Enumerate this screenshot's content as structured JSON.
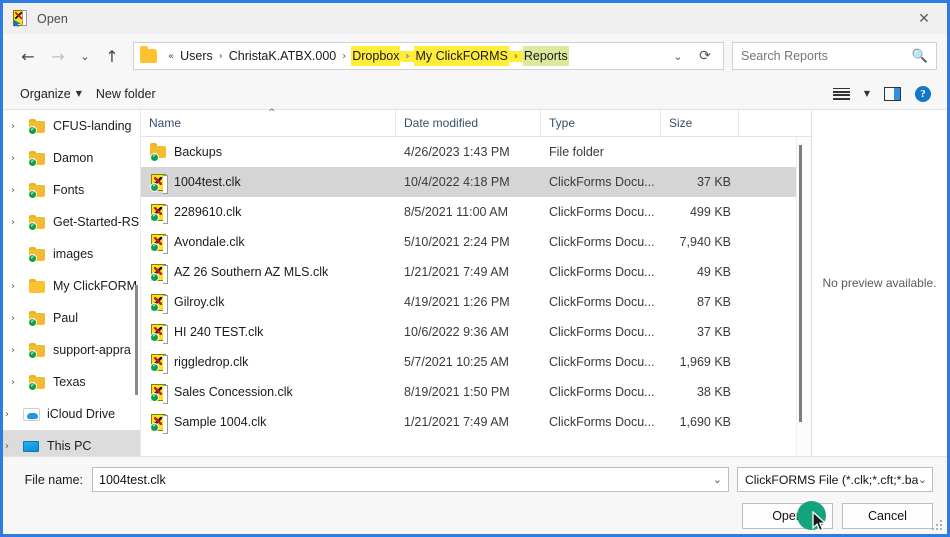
{
  "window": {
    "title": "Open",
    "title_icon": "clickforms-document-icon",
    "close_label": "✕"
  },
  "nav": {
    "back": "←",
    "forward": "→",
    "recent": "⌄",
    "up": "↑"
  },
  "breadcrumb": {
    "folder_icon": "folder-icon",
    "overflow": "«",
    "items": [
      {
        "label": "Users",
        "highlighted": false
      },
      {
        "label": "ChristaK.ATBX.000",
        "highlighted": false
      },
      {
        "label": "Dropbox",
        "highlighted": true
      },
      {
        "label": "My ClickFORMS",
        "highlighted": true
      },
      {
        "label": "Reports",
        "highlighted": true,
        "selected": true
      }
    ],
    "dropdown": "⌄",
    "refresh": "⟳"
  },
  "search": {
    "placeholder": "Search Reports",
    "icon": "search-icon"
  },
  "toolbar": {
    "organize_label": "Organize",
    "organize_caret": "▼",
    "new_folder_label": "New folder",
    "view_icon": "view-list-icon",
    "view_caret": "▼",
    "preview_pane_icon": "preview-pane-icon",
    "help_icon": "help-icon",
    "help_glyph": "?"
  },
  "sidebar": {
    "items": [
      {
        "label": "CFUS-landing",
        "icon": "folder-synced-icon",
        "expander": "›",
        "selected": false
      },
      {
        "label": "Damon",
        "icon": "folder-synced-icon",
        "expander": "›",
        "selected": false
      },
      {
        "label": "Fonts",
        "icon": "folder-synced-icon",
        "expander": "›",
        "selected": false
      },
      {
        "label": "Get-Started-RS",
        "icon": "folder-synced-icon",
        "expander": "›",
        "selected": false
      },
      {
        "label": "images",
        "icon": "folder-synced-icon",
        "expander": "",
        "selected": false
      },
      {
        "label": "My ClickFORM",
        "icon": "folder-icon",
        "expander": "›",
        "selected": false
      },
      {
        "label": "Paul",
        "icon": "folder-synced-icon",
        "expander": "›",
        "selected": false
      },
      {
        "label": "support-appra",
        "icon": "folder-synced-icon",
        "expander": "›",
        "selected": false
      },
      {
        "label": "Texas",
        "icon": "folder-synced-icon",
        "expander": "›",
        "selected": false
      },
      {
        "label": "iCloud Drive",
        "icon": "icloud-icon",
        "expander": "›",
        "selected": false
      },
      {
        "label": "This PC",
        "icon": "this-pc-icon",
        "expander": "›",
        "selected": true
      }
    ]
  },
  "filelist": {
    "columns": [
      {
        "label": "Name",
        "sorted": true,
        "sort_glyph": "^"
      },
      {
        "label": "Date modified",
        "sorted": false
      },
      {
        "label": "Type",
        "sorted": false
      },
      {
        "label": "Size",
        "sorted": false
      }
    ],
    "rows": [
      {
        "name": "Backups",
        "date": "4/26/2023 1:43 PM",
        "type": "File folder",
        "size": "",
        "icon": "folder-synced-icon",
        "selected": false
      },
      {
        "name": "1004test.clk",
        "date": "10/4/2022 4:18 PM",
        "type": "ClickForms Docu...",
        "size": "37 KB",
        "icon": "clickforms-file-icon",
        "selected": true
      },
      {
        "name": "2289610.clk",
        "date": "8/5/2021 11:00 AM",
        "type": "ClickForms Docu...",
        "size": "499 KB",
        "icon": "clickforms-file-icon",
        "selected": false
      },
      {
        "name": "Avondale.clk",
        "date": "5/10/2021 2:24 PM",
        "type": "ClickForms Docu...",
        "size": "7,940 KB",
        "icon": "clickforms-file-icon",
        "selected": false
      },
      {
        "name": "AZ 26 Southern AZ MLS.clk",
        "date": "1/21/2021 7:49 AM",
        "type": "ClickForms Docu...",
        "size": "49 KB",
        "icon": "clickforms-file-icon",
        "selected": false
      },
      {
        "name": "Gilroy.clk",
        "date": "4/19/2021 1:26 PM",
        "type": "ClickForms Docu...",
        "size": "87 KB",
        "icon": "clickforms-file-icon",
        "selected": false
      },
      {
        "name": "HI 240 TEST.clk",
        "date": "10/6/2022 9:36 AM",
        "type": "ClickForms Docu...",
        "size": "37 KB",
        "icon": "clickforms-file-icon",
        "selected": false
      },
      {
        "name": "riggledrop.clk",
        "date": "5/7/2021 10:25 AM",
        "type": "ClickForms Docu...",
        "size": "1,969 KB",
        "icon": "clickforms-file-icon",
        "selected": false
      },
      {
        "name": "Sales Concession.clk",
        "date": "8/19/2021 1:50 PM",
        "type": "ClickForms Docu...",
        "size": "38 KB",
        "icon": "clickforms-file-icon",
        "selected": false
      },
      {
        "name": "Sample 1004.clk",
        "date": "1/21/2021 7:49 AM",
        "type": "ClickForms Docu...",
        "size": "1,690 KB",
        "icon": "clickforms-file-icon",
        "selected": false
      }
    ]
  },
  "preview": {
    "message": "No preview available."
  },
  "footer": {
    "filename_label": "File name:",
    "filename_value": "1004test.clk",
    "filename_dropdown": "⌄",
    "filter_value": "ClickFORMS File (*.clk;*.cft;*.ba",
    "filter_dropdown": "⌄",
    "open_label": "Open",
    "cancel_label": "Cancel"
  },
  "colors": {
    "accent": "#2f7ce0",
    "highlight": "#ffed3a",
    "highlight_selected": "#dde89a",
    "cursor_dot": "#15a37d",
    "selection": "#d5d5d5"
  }
}
